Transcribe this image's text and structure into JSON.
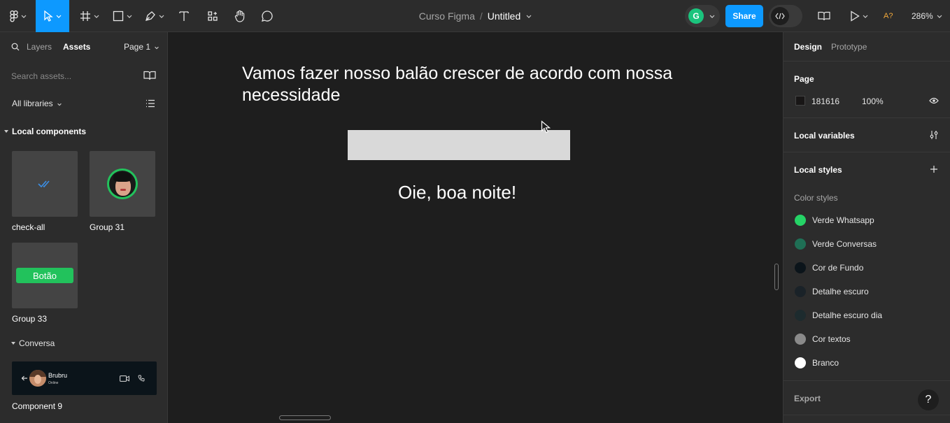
{
  "toolbar": {
    "project": "Curso Figma",
    "separator": "/",
    "file": "Untitled",
    "avatar_initial": "G",
    "share_label": "Share",
    "accessibility_flag": "A?",
    "zoom": "286%",
    "accent": "#0d99ff"
  },
  "left_panel": {
    "tabs": {
      "layers": "Layers",
      "assets": "Assets"
    },
    "page": "Page 1",
    "search_placeholder": "Search assets...",
    "libraries": "All libraries",
    "local_components_title": "Local components",
    "components": [
      {
        "label": "check-all"
      },
      {
        "label": "Group 31"
      },
      {
        "label": "Group 33",
        "preview_text": "Botão"
      }
    ],
    "conversa_title": "Conversa",
    "component9": {
      "label": "Component 9",
      "contact_name": "Brubru",
      "contact_status": "Online"
    }
  },
  "canvas": {
    "heading": "Vamos fazer nosso balão crescer de acordo com nossa necessidade",
    "message": "Oie, boa noite!"
  },
  "right_panel": {
    "tabs": {
      "design": "Design",
      "prototype": "Prototype"
    },
    "page_title": "Page",
    "page_color_hex": "181616",
    "page_opacity": "100%",
    "local_variables": "Local variables",
    "local_styles": "Local styles",
    "color_styles_title": "Color styles",
    "color_styles": [
      {
        "name": "Verde Whatsapp",
        "color": "#25d366"
      },
      {
        "name": "Verde Conversas",
        "color": "#1f6f55"
      },
      {
        "name": "Cor de Fundo",
        "color": "#0b141a"
      },
      {
        "name": "Detalhe escuro",
        "color": "#1a2228"
      },
      {
        "name": "Detalhe escuro dia",
        "color": "#1d2b2e"
      },
      {
        "name": "Cor textos",
        "color": "#8a8a8a"
      },
      {
        "name": "Branco",
        "color": "#ffffff"
      }
    ],
    "export": "Export",
    "help": "?"
  }
}
